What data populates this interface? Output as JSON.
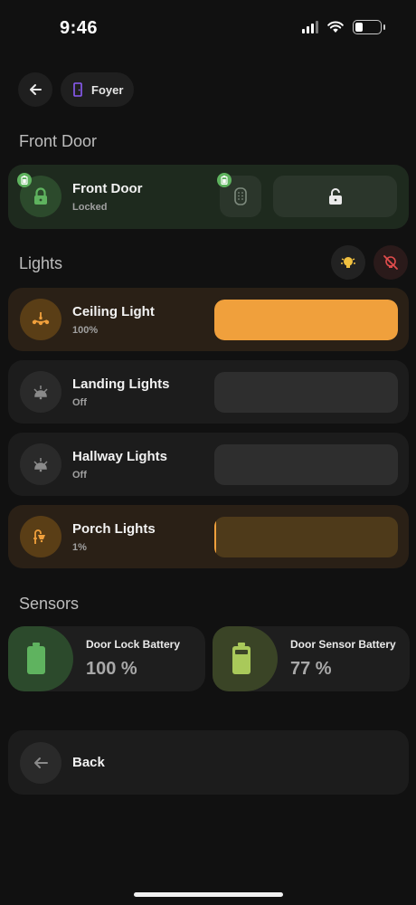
{
  "status_bar": {
    "time": "9:46"
  },
  "nav": {
    "back_icon": "arrow-left-icon",
    "room_chip": {
      "label": "Foyer",
      "icon": "door-icon"
    }
  },
  "sections": {
    "front_door": "Front Door",
    "lights": "Lights",
    "sensors": "Sensors"
  },
  "front_door_card": {
    "title": "Front Door",
    "state": "Locked",
    "accent": "#5fb35f"
  },
  "lights": [
    {
      "name": "Ceiling Light",
      "state": "100%",
      "level": 1.0,
      "on": true,
      "icon": "chandelier-icon"
    },
    {
      "name": "Landing Lights",
      "state": "Off",
      "level": 0,
      "on": false,
      "icon": "ceiling-light-icon"
    },
    {
      "name": "Hallway Lights",
      "state": "Off",
      "level": 0,
      "on": false,
      "icon": "ceiling-light-icon"
    },
    {
      "name": "Porch Lights",
      "state": "1%",
      "level": 0.01,
      "on": true,
      "icon": "outdoor-lamp-icon"
    }
  ],
  "sensors": [
    {
      "name": "Door Lock Battery",
      "value": "100 %",
      "level": 1.0,
      "color": "#5fb35f"
    },
    {
      "name": "Door Sensor Battery",
      "value": "77 %",
      "level": 0.77,
      "color": "#a9c95a"
    }
  ],
  "back_card": {
    "label": "Back"
  },
  "colors": {
    "accent_orange": "#f0a03c",
    "green": "#5fb35f",
    "red": "#e04c4c",
    "background": "#111111"
  }
}
